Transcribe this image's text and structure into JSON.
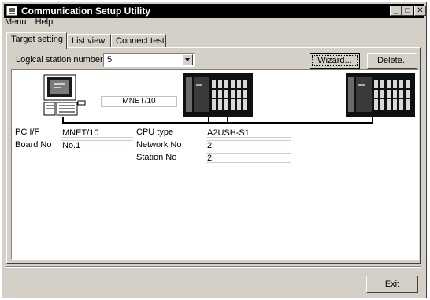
{
  "window": {
    "title": "Communication Setup Utility"
  },
  "titlebar_buttons": {
    "minimize": "_",
    "maximize": "□",
    "close": "✕"
  },
  "menu": [
    {
      "label": "Menu"
    },
    {
      "label": "Help"
    }
  ],
  "tabs": [
    {
      "label": "Target setting",
      "active": true
    },
    {
      "label": "List view",
      "active": false
    },
    {
      "label": "Connect test",
      "active": false
    }
  ],
  "logical_station": {
    "label": "Logical station number",
    "value": "5"
  },
  "buttons": {
    "wizard": "Wizard...",
    "delete": "Delete..",
    "exit": "Exit"
  },
  "diagram": {
    "network_label": "MNET/10",
    "pc": {
      "pc_if_label": "PC I/F",
      "pc_if_value": "MNET/10",
      "board_no_label": "Board No",
      "board_no_value": "No.1"
    },
    "target": {
      "cpu_type_label": "CPU type",
      "cpu_type_value": "A2USH-S1",
      "network_no_label": "Network No",
      "network_no_value": "2",
      "station_no_label": "Station No",
      "station_no_value": "2"
    }
  },
  "icons": {
    "app": "app-icon",
    "pc": "pc-icon",
    "plc": "plc-icon",
    "dropdown": "chevron-down-icon"
  },
  "colors": {
    "titlebar": "#000000",
    "face": "#d4d0c8",
    "plc_body": "#101010"
  }
}
